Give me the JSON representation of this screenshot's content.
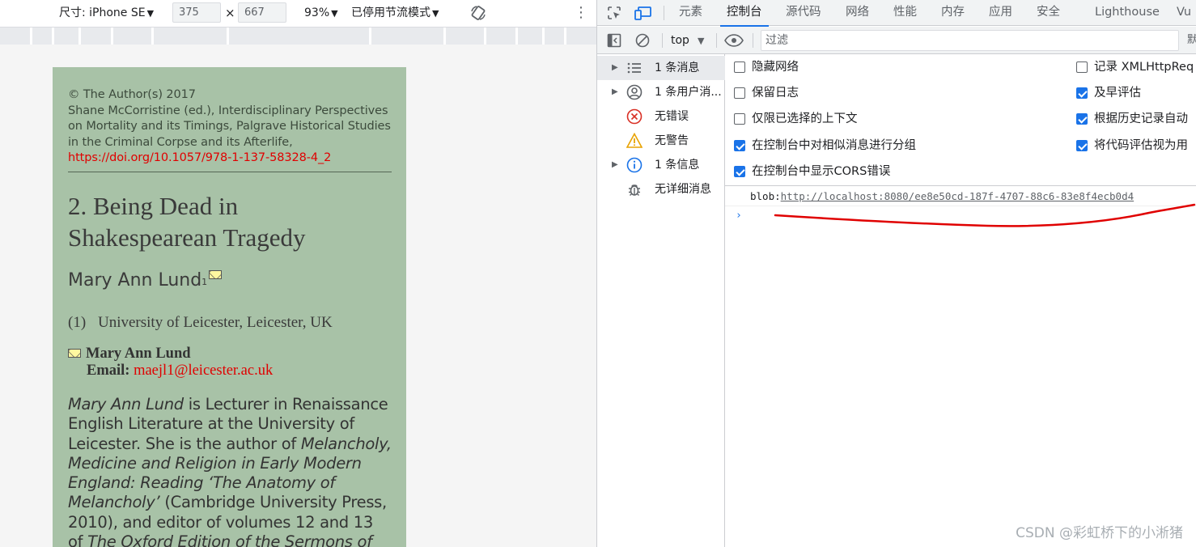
{
  "device_toolbar": {
    "dimensions_label": "尺寸: iPhone SE",
    "width_value": "375",
    "times_symbol": "×",
    "height_value": "667",
    "zoom_label": "93%",
    "throttle_label": "已停用节流模式",
    "dropdown_glyph": "▼",
    "more_glyph": "⋮"
  },
  "page": {
    "copyright": "© The Author(s) 2017",
    "citation": "Shane McCorristine (ed.), Interdisciplinary Perspectives on Mortality and its Timings, Palgrave Historical Studies in the Criminal Corpse and its Afterlife,",
    "doi": "https://doi.org/10.1057/978-1-137-58328-4_2",
    "chapter_line1": "2. Being Dead in",
    "chapter_line2": "Shakespearean Tragedy",
    "author": "Mary Ann Lund",
    "author_sup": "1",
    "affil_num": "(1)",
    "affil_text": "University of Leicester, Leicester, UK",
    "contact_name": "Mary Ann Lund",
    "email_label": "Email:",
    "email": "maejl1@leicester.ac.uk",
    "bio_author": "Mary Ann Lund",
    "bio_1": " is Lecturer in Renaissance English Literature at the University of Leicester. She is the author of ",
    "bio_book": "Melancholy, Medicine and Religion in Early Modern England: Reading ‘The Anatomy of Melancholy’",
    "bio_2": " (Cambridge University Press, 2010), and editor of volumes 12 and 13 of ",
    "bio_3": "The Oxford Edition of the Sermons of John"
  },
  "devtools": {
    "tabs": [
      "元素",
      "控制台",
      "源代码",
      "网络",
      "性能",
      "内存",
      "应用",
      "安全",
      "Lighthouse",
      "Vu"
    ],
    "active_tab": "控制台",
    "context": "top",
    "filter_placeholder": "过滤",
    "sidebar": [
      {
        "label": "1 条消息",
        "icon": "list-icon",
        "arrow": true,
        "selected": true
      },
      {
        "label": "1 条用户消...",
        "icon": "user-icon",
        "arrow": true,
        "selected": false
      },
      {
        "label": "无错误",
        "icon": "error-icon",
        "arrow": false,
        "selected": false
      },
      {
        "label": "无警告",
        "icon": "warning-icon",
        "arrow": false,
        "selected": false
      },
      {
        "label": "1 条信息",
        "icon": "info-icon",
        "arrow": true,
        "selected": false
      },
      {
        "label": "无详细消息",
        "icon": "bug-icon",
        "arrow": false,
        "selected": false
      }
    ],
    "settings_left": [
      {
        "label": "隐藏网络",
        "checked": false
      },
      {
        "label": "保留日志",
        "checked": false
      },
      {
        "label": "仅限已选择的上下文",
        "checked": false
      },
      {
        "label": "在控制台中对相似消息进行分组",
        "checked": true
      },
      {
        "label": "在控制台中显示CORS错误",
        "checked": true
      }
    ],
    "settings_right": [
      {
        "label": "记录 XMLHttpReq",
        "checked": false
      },
      {
        "label": "及早评估",
        "checked": true
      },
      {
        "label": "根据历史记录自动",
        "checked": true
      },
      {
        "label": "将代码评估视为用",
        "checked": true
      }
    ],
    "log_prefix": "blob:",
    "log_url": "http://localhost:8080/ee8e50cd-187f-4707-88c6-83e8f4ecb0d4",
    "prompt_glyph": "›"
  },
  "colors": {
    "page_background": "#a8c2a7",
    "accent_blue": "#1a73e8",
    "annotation_red": "#e00000"
  },
  "watermark": "CSDN @彩虹桥下的小淅猪"
}
